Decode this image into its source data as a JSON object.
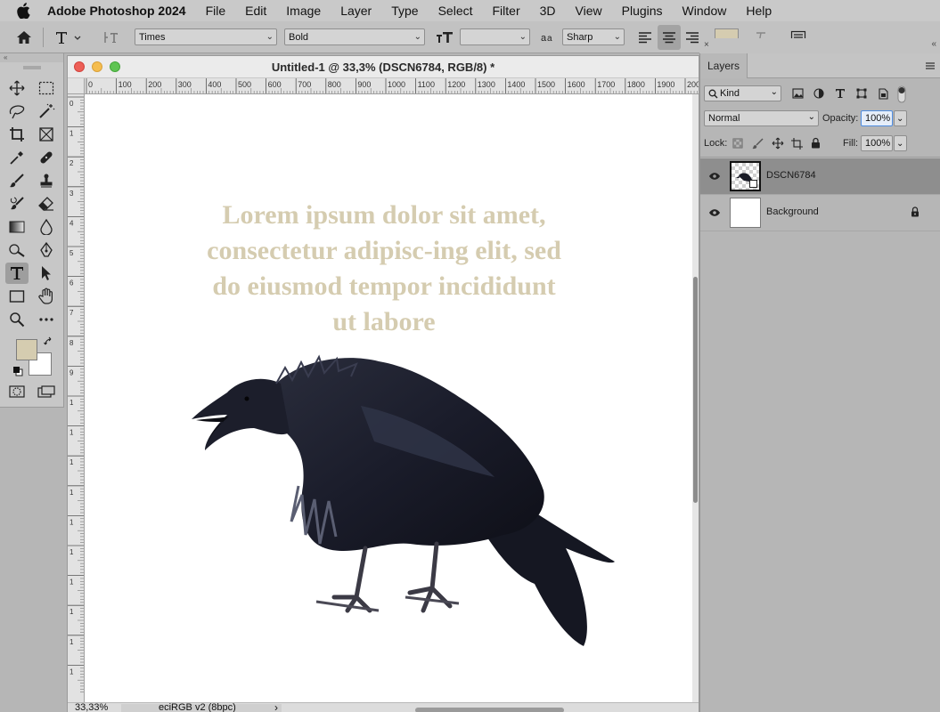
{
  "menubar": {
    "app_name": "Adobe Photoshop 2024",
    "items": [
      "File",
      "Edit",
      "Image",
      "Layer",
      "Type",
      "Select",
      "Filter",
      "3D",
      "View",
      "Plugins",
      "Window",
      "Help"
    ]
  },
  "options_bar": {
    "font_family": "Times",
    "font_style": "Bold",
    "font_size": "",
    "antialias": "Sharp",
    "text_color": "#d5ccb0"
  },
  "toolbar": {
    "foreground_color": "#d5ccb0",
    "background_color": "#ffffff",
    "active_tool": "type-tool"
  },
  "document": {
    "title": "Untitled-1 @ 33,3% (DSCN6784, RGB/8) *",
    "ruler_top_ticks": [
      "0",
      "100",
      "200",
      "300",
      "400",
      "500",
      "600",
      "700",
      "800",
      "900",
      "1000",
      "1100",
      "1200",
      "1300",
      "1400",
      "1500",
      "1600",
      "1700",
      "1800",
      "1900",
      "200"
    ],
    "ruler_left_ticks": [
      "0",
      "1",
      "2",
      "3",
      "4",
      "5",
      "6",
      "7",
      "8",
      "9",
      "1",
      "1",
      "1",
      "1",
      "1",
      "1",
      "1",
      "1",
      "1",
      "1"
    ],
    "canvas_text": "Lorem ipsum dolor sit amet, consectetur adipisc-ing elit, sed do eiusmod tempor incididunt ut labore",
    "status": {
      "zoom": "33,33%",
      "profile": "eciRGB v2 (8bpc)"
    }
  },
  "layers_panel": {
    "tab_label": "Layers",
    "filter_kind": "Kind",
    "blend_mode": "Normal",
    "opacity_label": "Opacity:",
    "opacity_value": "100%",
    "lock_label": "Lock:",
    "fill_label": "Fill:",
    "fill_value": "100%",
    "layers": [
      {
        "name": "DSCN6784",
        "visible": true,
        "selected": true
      },
      {
        "name": "Background",
        "visible": true,
        "locked": true
      }
    ]
  }
}
